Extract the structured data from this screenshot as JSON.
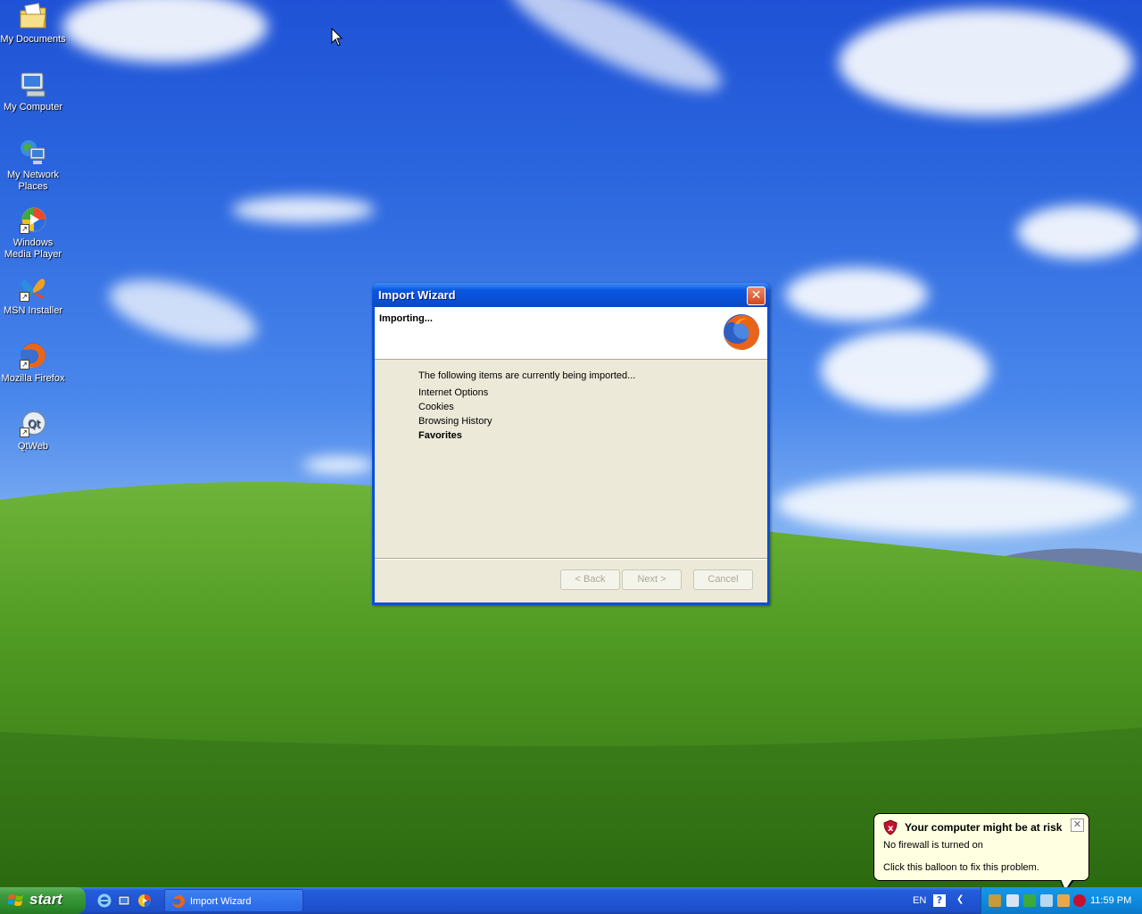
{
  "desktop": {
    "icons": [
      {
        "label": "My Documents",
        "icon": "folder-documents-icon"
      },
      {
        "label": "My Computer",
        "icon": "computer-icon"
      },
      {
        "label": "My Network Places",
        "icon": "network-places-icon"
      },
      {
        "label": "Windows Media Player",
        "icon": "media-player-icon"
      },
      {
        "label": "MSN Installer",
        "icon": "msn-butterfly-icon"
      },
      {
        "label": "Mozilla Firefox",
        "icon": "firefox-icon"
      },
      {
        "label": "QtWeb",
        "icon": "qtweb-icon"
      }
    ]
  },
  "dialog": {
    "title": "Import Wizard",
    "close_label": "✕",
    "heading": "Importing...",
    "logo_icon": "firefox-logo-icon",
    "intro": "The following items are currently being imported...",
    "items": [
      {
        "label": "Internet Options",
        "active": false
      },
      {
        "label": "Cookies",
        "active": false
      },
      {
        "label": "Browsing History",
        "active": false
      },
      {
        "label": "Favorites",
        "active": true
      }
    ],
    "buttons": {
      "back": "< Back",
      "next": "Next >",
      "cancel": "Cancel"
    }
  },
  "balloon": {
    "title": "Your computer might be at risk",
    "line1": "No firewall is turned on",
    "line2": "Click this balloon to fix this problem.",
    "close_label": "✕",
    "icon": "security-shield-icon"
  },
  "taskbar": {
    "start_label": "start",
    "quick_launch": [
      "internet-explorer-icon",
      "show-desktop-icon",
      "media-player-icon"
    ],
    "task": "Import Wizard",
    "language": "EN",
    "help_label": "?",
    "clock": "11:59 PM",
    "colors": {
      "bar": "#245edb",
      "start": "#3c9a3c",
      "tray": "#0e8bdf"
    }
  }
}
